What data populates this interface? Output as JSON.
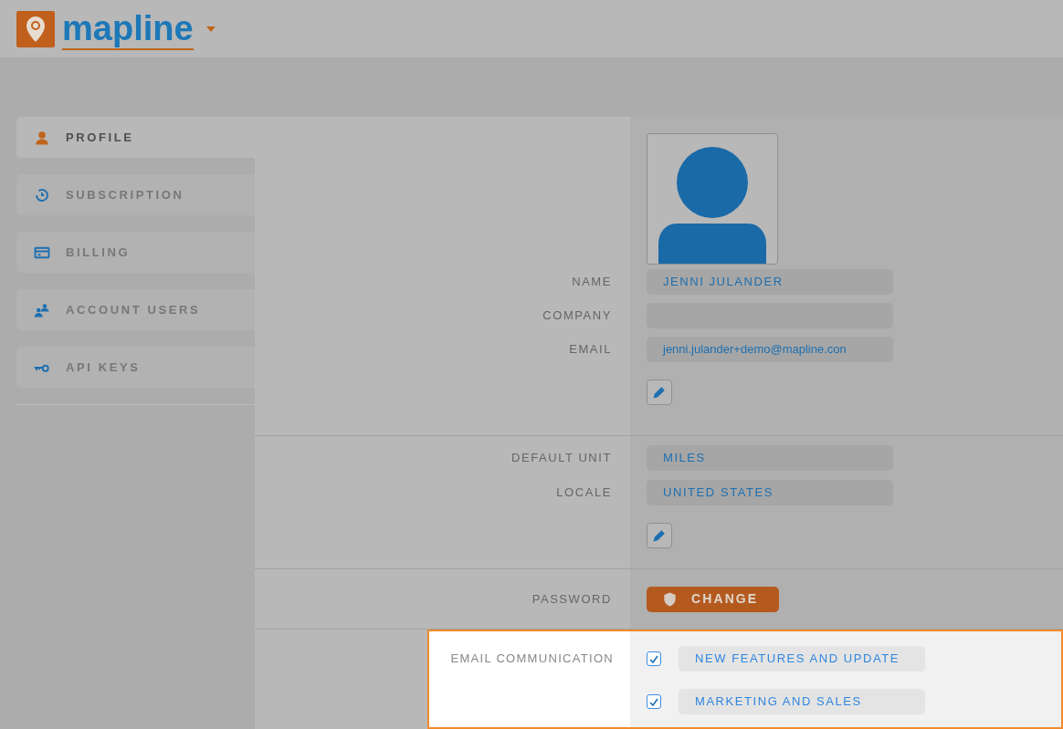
{
  "header": {
    "logo_text": "mapline"
  },
  "sidebar": {
    "items": [
      {
        "label": "PROFILE",
        "selected": true
      },
      {
        "label": "SUBSCRIPTION",
        "selected": false
      },
      {
        "label": "BILLING",
        "selected": false
      },
      {
        "label": "ACCOUNT USERS",
        "selected": false
      },
      {
        "label": "API KEYS",
        "selected": false
      }
    ]
  },
  "profile": {
    "fields": [
      {
        "label": "NAME",
        "value": "JENNI JULANDER"
      },
      {
        "label": "COMPANY"
      },
      {
        "label": "EMAIL",
        "value": "jenni.julander+demo@mapline.con"
      }
    ]
  },
  "preferences": {
    "fields": [
      {
        "label": "DEFAULT UNIT",
        "value": "MILES"
      },
      {
        "label": "LOCALE",
        "value": "UNITED STATES"
      }
    ]
  },
  "password": {
    "label": "PASSWORD",
    "button": "CHANGE"
  },
  "email_communication": {
    "label": "EMAIL COMMUNICATION",
    "options": [
      {
        "label": "NEW FEATURES AND UPDATE",
        "checked": true
      },
      {
        "label": "MARKETING AND SALES",
        "checked": true
      }
    ]
  }
}
